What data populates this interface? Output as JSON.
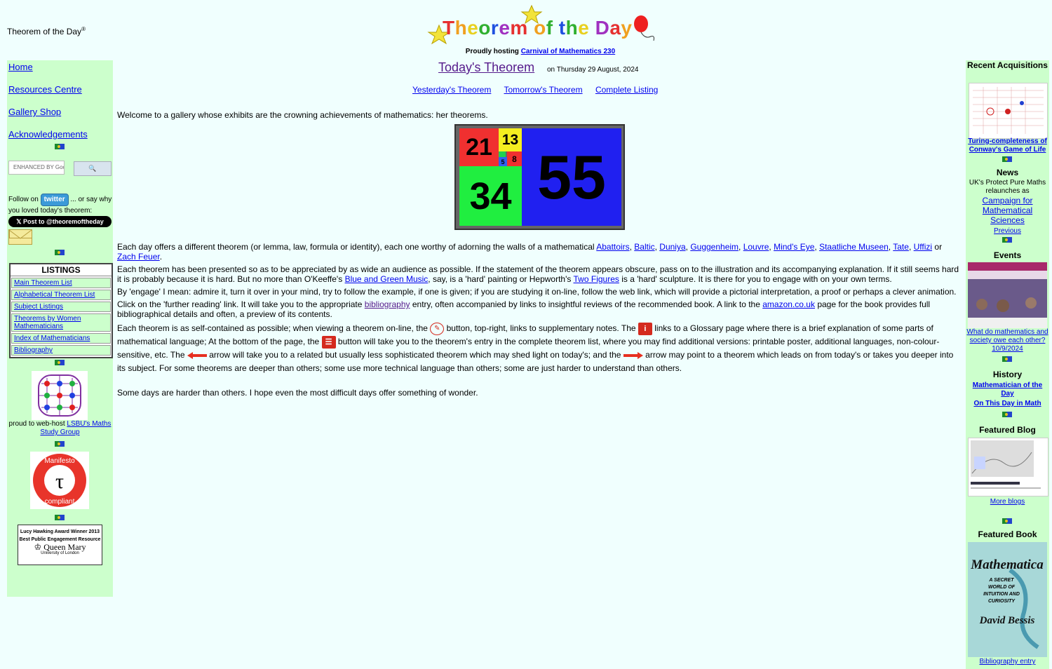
{
  "header": {
    "site_title": "Theorem of the Day",
    "site_title_mark": "®",
    "logo_text": "Theorem of the Day",
    "hosting_prefix": "Proudly hosting",
    "hosting_link": "Carnival of Mathematics 230"
  },
  "sidebar": {
    "nav": [
      "Home",
      "Resources Centre",
      "Gallery Shop",
      "Acknowledgements"
    ],
    "search_placeholder": "ENHANCED BY Google",
    "follow_prefix": "Follow on",
    "twitter_label": "twitter",
    "follow_suffix": "... or say why you loved today's theorem:",
    "post_button": "Post to @theoremoftheday",
    "listings_title": "LISTINGS",
    "listings": [
      "Main Theorem List",
      "Alphabetical Theorem List",
      "Subject Listings",
      "Theorems by Women Mathematicians",
      "Index of Mathematicians",
      "Bibliography"
    ],
    "lsbu_prefix": "proud to web-host",
    "lsbu_link": "LSBU's Maths Study Group",
    "manifesto_top": "Manifesto",
    "manifesto_symbol": "τ",
    "manifesto_bottom": "compliant",
    "qmul_line1": "Lucy Hawking Award Winner 2013",
    "qmul_line2": "Best Public Engagement Resource",
    "qmul_name": "Queen Mary",
    "qmul_sub": "University of London"
  },
  "main": {
    "today_title": "Today's Theorem",
    "today_date": "on Thursday 29 August, 2024",
    "nav": [
      "Yesterday's Theorem",
      "Tomorrow's Theorem",
      "Complete Listing"
    ],
    "welcome": "Welcome to a gallery whose exhibits are the crowning achievements of mathematics: her theorems.",
    "fib": [
      "21",
      "13",
      "5",
      "8",
      "34",
      "55"
    ],
    "p1_text": "Each day offers a different theorem (or lemma, law, formula or identity), each one worthy of adorning the walls of a mathematical",
    "museums": [
      "Abattoirs",
      "Baltic",
      "Duniya",
      "Guggenheim",
      "Louvre",
      "Mind's Eye",
      "Staatliche Museen",
      "Tate",
      "Uffizi"
    ],
    "p1_or": "or",
    "p1_last": "Zach Feuer",
    "p2_a": "Each theorem has been presented so as to be appreciated by as wide an audience as possible. If the statement of the theorem appears obscure, pass on to the illustration and its accompanying explanation. If it still seems hard it is probably because it is hard. But no more than O'Keeffe's",
    "p2_link1": "Blue and Green Music",
    "p2_b": ", say, is a 'hard' painting or Hepworth's",
    "p2_link2": "Two Figures",
    "p2_c": "is a 'hard' sculpture. It is there for you to engage with on your own terms.",
    "p3": "By 'engage' I mean: admire it, turn it over in your mind, try to follow the example, if one is given; if you are studying it on-line, follow the web link, which will provide a pictorial interpretation, a proof or perhaps a clever animation.",
    "p4_a": "Click on the 'further reading' link. It will take you to the appropriate",
    "p4_link1": "bibliography",
    "p4_b": "entry, often accompanied by links to insightful reviews of the recommended book. A link to the",
    "p4_link2": "amazon.co.uk",
    "p4_c": "page for the book provides full bibliographical details and often, a preview of its contents.",
    "p5_a": "Each theorem is as self-contained as possible; when viewing a theorem on-line, the",
    "p5_b": "button, top-right, links to supplementary notes. The",
    "p5_c": "links to a Glossary page where there is a brief explanation of some parts of mathematical language; At the bottom of the page, the",
    "p5_d": "button will take you to the theorem's entry in the complete theorem list, where you may find additional versions: printable poster, additional languages, non-colour-sensitive, etc. The",
    "p5_e": "arrow will take you to a related but usually less sophisticated theorem which may shed light on today's; and the",
    "p5_f": "arrow may point to a theorem which leads on from today's or takes you deeper into its subject. For some theorems are deeper than others; some use more technical language than others; some are just harder to understand than others.",
    "p6": "Some days are harder than others. I hope even the most difficult days offer something of wonder."
  },
  "right": {
    "recent_title": "Recent Acquisitions",
    "recent_link": "Turing-completeness of Conway's Game of Life",
    "news_title": "News",
    "news_text": "UK's Protect Pure Maths relaunches as",
    "news_link": "Campaign for Mathematical Sciences",
    "news_previous": "Previous",
    "events_title": "Events",
    "events_link": "What do mathematics and society owe each other? 10/9/2024",
    "history_title": "History",
    "history_link1": "Mathematician of the Day",
    "history_link2": "On This Day in Math",
    "blog_title": "Featured Blog",
    "blog_link": "More blogs",
    "book_title": "Featured Book",
    "book_cover_title": "Mathematica",
    "book_cover_sub": "A SECRET WORLD OF INTUITION AND CURIOSITY",
    "book_cover_author": "David Bessis",
    "book_link": "Bibliography entry"
  }
}
